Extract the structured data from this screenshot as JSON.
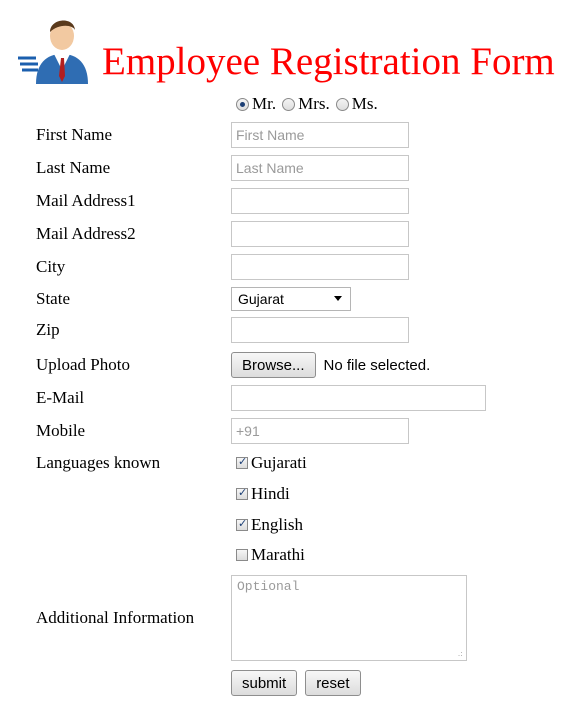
{
  "header": {
    "title": "Employee Registration Form"
  },
  "salutation": {
    "options": [
      {
        "label": "Mr.",
        "checked": true
      },
      {
        "label": "Mrs.",
        "checked": false
      },
      {
        "label": "Ms.",
        "checked": false
      }
    ]
  },
  "fields": {
    "first_name": {
      "label": "First Name",
      "placeholder": "First Name",
      "value": ""
    },
    "last_name": {
      "label": "Last Name",
      "placeholder": "Last Name",
      "value": ""
    },
    "mail1": {
      "label": "Mail Address1",
      "value": ""
    },
    "mail2": {
      "label": "Mail Address2",
      "value": ""
    },
    "city": {
      "label": "City",
      "value": ""
    },
    "state": {
      "label": "State",
      "selected": "Gujarat"
    },
    "zip": {
      "label": "Zip",
      "value": ""
    },
    "photo": {
      "label": "Upload Photo",
      "button": "Browse...",
      "status": "No file selected."
    },
    "email": {
      "label": "E-Mail",
      "value": ""
    },
    "mobile": {
      "label": "Mobile",
      "placeholder": "+91"
    }
  },
  "languages": {
    "label": "Languages known",
    "items": [
      {
        "label": "Gujarati",
        "checked": true
      },
      {
        "label": "Hindi",
        "checked": true
      },
      {
        "label": "English",
        "checked": true
      },
      {
        "label": "Marathi",
        "checked": false
      }
    ]
  },
  "additional": {
    "label": "Additional Information",
    "placeholder": "Optional"
  },
  "actions": {
    "submit": "submit",
    "reset": "reset"
  }
}
